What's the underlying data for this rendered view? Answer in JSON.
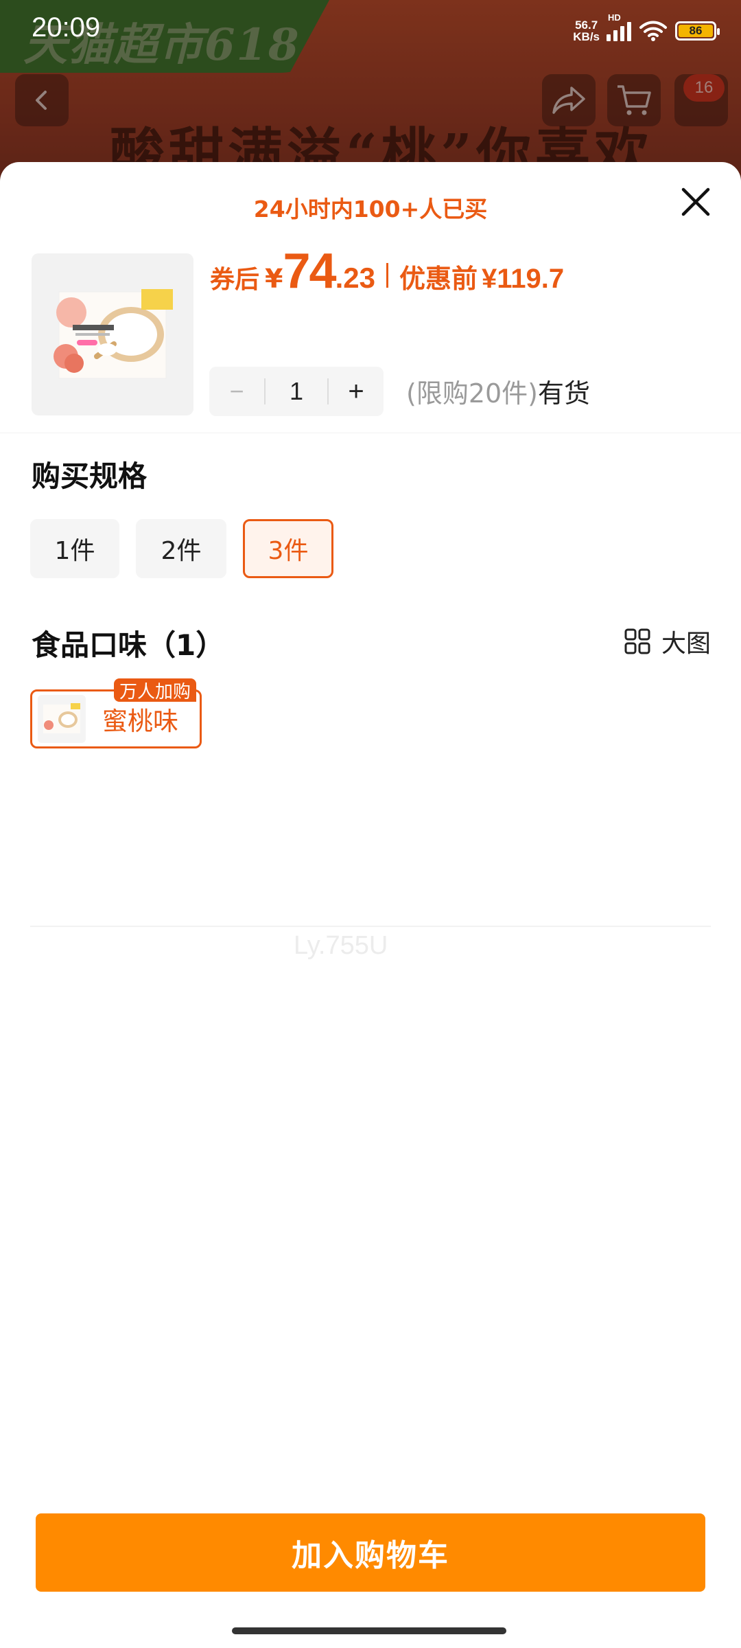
{
  "status_bar": {
    "time": "20:09",
    "net_speed_top": "56.7",
    "net_speed_bottom": "KB/s",
    "battery": "86",
    "hd_label": "HD"
  },
  "background_page": {
    "promo_banner": "天猫超市618",
    "hero_title": "酸甜满溢“桃”你喜欢",
    "cart_badge": "16"
  },
  "sheet": {
    "sold_count": "24小时内100+人已买",
    "price": {
      "after_coupon_label": "券后",
      "currency": "¥",
      "integer": "74",
      "decimal": ".23",
      "before_label": "优惠前",
      "before_value": "¥119.7"
    },
    "quantity": {
      "minus": "−",
      "value": "1",
      "plus": "+"
    },
    "stock": {
      "limit": "(限购20件)",
      "status": "有货"
    },
    "spec_section": {
      "title": "购买规格",
      "options": [
        "1件",
        "2件",
        "3件"
      ],
      "selected": "3件"
    },
    "flavor_section": {
      "title": "食品口味（1）",
      "big_image_label": "大图",
      "options": [
        "蜜桃味"
      ],
      "selected": "蜜桃味",
      "hot_tag": "万人加购"
    },
    "watermark": "Ly.755U",
    "add_to_cart": "加入购物车"
  },
  "colors": {
    "accent": "#ea5a13",
    "cta": "#ff8a00"
  }
}
